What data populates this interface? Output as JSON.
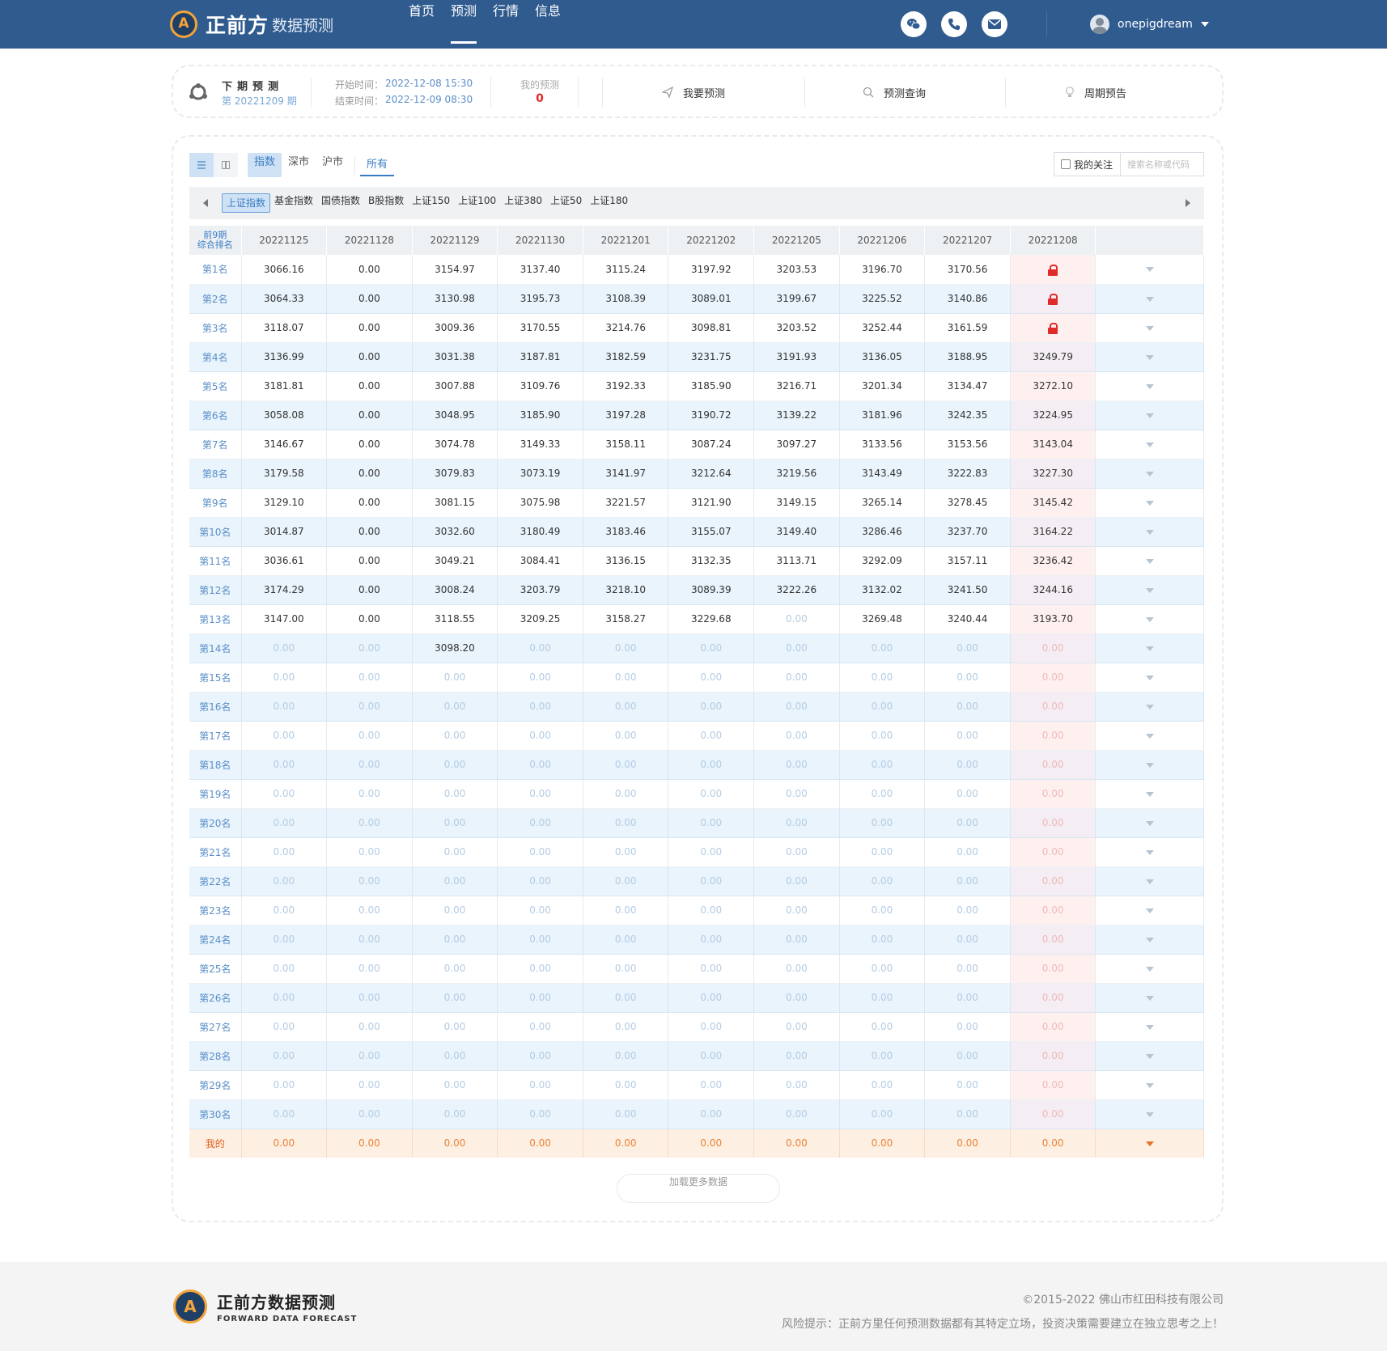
{
  "header": {
    "logo_main": "正前方",
    "logo_sub": "数据预测",
    "nav": [
      "首页",
      "预测",
      "行情",
      "信息"
    ],
    "active_nav": "预测",
    "username": "onepigdream"
  },
  "info": {
    "title": "下期预测",
    "period": "第 20221209 期",
    "start_label": "开始时间：",
    "start_time": "2022-12-08 15:30",
    "end_label": "结束时间：",
    "end_time": "2022-12-09 08:30",
    "my_prediction_label": "我的预测",
    "my_prediction_count": "0",
    "actions": [
      "我要预测",
      "预测查询",
      "周期预告"
    ]
  },
  "filters": {
    "categories": [
      "指数",
      "深市",
      "沪市"
    ],
    "active_category": "指数",
    "all_label": "所有",
    "follow_label": "我的关注",
    "search_placeholder": "搜索名称或代码"
  },
  "index_tabs": {
    "items": [
      "上证指数",
      "基金指数",
      "国债指数",
      "B股指数",
      "上证150",
      "上证100",
      "上证380",
      "上证50",
      "上证180"
    ],
    "active": "上证指数"
  },
  "table": {
    "rank_header_line1": "前9期",
    "rank_header_line2": "综合排名",
    "columns": [
      "20221125",
      "20221128",
      "20221129",
      "20221130",
      "20221201",
      "20221202",
      "20221205",
      "20221206",
      "20221207",
      "20221208"
    ],
    "rows": [
      {
        "rank": "第1名",
        "values": [
          "3066.16",
          "0.00",
          "3154.97",
          "3137.40",
          "3115.24",
          "3197.92",
          "3203.53",
          "3196.70",
          "3170.56",
          "lock"
        ]
      },
      {
        "rank": "第2名",
        "values": [
          "3064.33",
          "0.00",
          "3130.98",
          "3195.73",
          "3108.39",
          "3089.01",
          "3199.67",
          "3225.52",
          "3140.86",
          "lock"
        ]
      },
      {
        "rank": "第3名",
        "values": [
          "3118.07",
          "0.00",
          "3009.36",
          "3170.55",
          "3214.76",
          "3098.81",
          "3203.52",
          "3252.44",
          "3161.59",
          "lock"
        ]
      },
      {
        "rank": "第4名",
        "values": [
          "3136.99",
          "0.00",
          "3031.38",
          "3187.81",
          "3182.59",
          "3231.75",
          "3191.93",
          "3136.05",
          "3188.95",
          "3249.79"
        ]
      },
      {
        "rank": "第5名",
        "values": [
          "3181.81",
          "0.00",
          "3007.88",
          "3109.76",
          "3192.33",
          "3185.90",
          "3216.71",
          "3201.34",
          "3134.47",
          "3272.10"
        ]
      },
      {
        "rank": "第6名",
        "values": [
          "3058.08",
          "0.00",
          "3048.95",
          "3185.90",
          "3197.28",
          "3190.72",
          "3139.22",
          "3181.96",
          "3242.35",
          "3224.95"
        ]
      },
      {
        "rank": "第7名",
        "values": [
          "3146.67",
          "0.00",
          "3074.78",
          "3149.33",
          "3158.11",
          "3087.24",
          "3097.27",
          "3133.56",
          "3153.56",
          "3143.04"
        ]
      },
      {
        "rank": "第8名",
        "values": [
          "3179.58",
          "0.00",
          "3079.83",
          "3073.19",
          "3141.97",
          "3212.64",
          "3219.56",
          "3143.49",
          "3222.83",
          "3227.30"
        ]
      },
      {
        "rank": "第9名",
        "values": [
          "3129.10",
          "0.00",
          "3081.15",
          "3075.98",
          "3221.57",
          "3121.90",
          "3149.15",
          "3265.14",
          "3278.45",
          "3145.42"
        ]
      },
      {
        "rank": "第10名",
        "values": [
          "3014.87",
          "0.00",
          "3032.60",
          "3180.49",
          "3183.46",
          "3155.07",
          "3149.40",
          "3286.46",
          "3237.70",
          "3164.22"
        ]
      },
      {
        "rank": "第11名",
        "values": [
          "3036.61",
          "0.00",
          "3049.21",
          "3084.41",
          "3136.15",
          "3132.35",
          "3113.71",
          "3292.09",
          "3157.11",
          "3236.42"
        ]
      },
      {
        "rank": "第12名",
        "values": [
          "3174.29",
          "0.00",
          "3008.24",
          "3203.79",
          "3218.10",
          "3089.39",
          "3222.26",
          "3132.02",
          "3241.50",
          "3244.16"
        ]
      },
      {
        "rank": "第13名",
        "values": [
          "3147.00",
          "0.00",
          "3118.55",
          "3209.25",
          "3158.27",
          "3229.68",
          "0.00",
          "3269.48",
          "3240.44",
          "3193.70"
        ]
      },
      {
        "rank": "第14名",
        "values": [
          "0.00",
          "0.00",
          "3098.20",
          "0.00",
          "0.00",
          "0.00",
          "0.00",
          "0.00",
          "0.00",
          "0.00"
        ]
      },
      {
        "rank": "第15名",
        "values": [
          "0.00",
          "0.00",
          "0.00",
          "0.00",
          "0.00",
          "0.00",
          "0.00",
          "0.00",
          "0.00",
          "0.00"
        ]
      },
      {
        "rank": "第16名",
        "values": [
          "0.00",
          "0.00",
          "0.00",
          "0.00",
          "0.00",
          "0.00",
          "0.00",
          "0.00",
          "0.00",
          "0.00"
        ]
      },
      {
        "rank": "第17名",
        "values": [
          "0.00",
          "0.00",
          "0.00",
          "0.00",
          "0.00",
          "0.00",
          "0.00",
          "0.00",
          "0.00",
          "0.00"
        ]
      },
      {
        "rank": "第18名",
        "values": [
          "0.00",
          "0.00",
          "0.00",
          "0.00",
          "0.00",
          "0.00",
          "0.00",
          "0.00",
          "0.00",
          "0.00"
        ]
      },
      {
        "rank": "第19名",
        "values": [
          "0.00",
          "0.00",
          "0.00",
          "0.00",
          "0.00",
          "0.00",
          "0.00",
          "0.00",
          "0.00",
          "0.00"
        ]
      },
      {
        "rank": "第20名",
        "values": [
          "0.00",
          "0.00",
          "0.00",
          "0.00",
          "0.00",
          "0.00",
          "0.00",
          "0.00",
          "0.00",
          "0.00"
        ]
      },
      {
        "rank": "第21名",
        "values": [
          "0.00",
          "0.00",
          "0.00",
          "0.00",
          "0.00",
          "0.00",
          "0.00",
          "0.00",
          "0.00",
          "0.00"
        ]
      },
      {
        "rank": "第22名",
        "values": [
          "0.00",
          "0.00",
          "0.00",
          "0.00",
          "0.00",
          "0.00",
          "0.00",
          "0.00",
          "0.00",
          "0.00"
        ]
      },
      {
        "rank": "第23名",
        "values": [
          "0.00",
          "0.00",
          "0.00",
          "0.00",
          "0.00",
          "0.00",
          "0.00",
          "0.00",
          "0.00",
          "0.00"
        ]
      },
      {
        "rank": "第24名",
        "values": [
          "0.00",
          "0.00",
          "0.00",
          "0.00",
          "0.00",
          "0.00",
          "0.00",
          "0.00",
          "0.00",
          "0.00"
        ]
      },
      {
        "rank": "第25名",
        "values": [
          "0.00",
          "0.00",
          "0.00",
          "0.00",
          "0.00",
          "0.00",
          "0.00",
          "0.00",
          "0.00",
          "0.00"
        ]
      },
      {
        "rank": "第26名",
        "values": [
          "0.00",
          "0.00",
          "0.00",
          "0.00",
          "0.00",
          "0.00",
          "0.00",
          "0.00",
          "0.00",
          "0.00"
        ]
      },
      {
        "rank": "第27名",
        "values": [
          "0.00",
          "0.00",
          "0.00",
          "0.00",
          "0.00",
          "0.00",
          "0.00",
          "0.00",
          "0.00",
          "0.00"
        ]
      },
      {
        "rank": "第28名",
        "values": [
          "0.00",
          "0.00",
          "0.00",
          "0.00",
          "0.00",
          "0.00",
          "0.00",
          "0.00",
          "0.00",
          "0.00"
        ]
      },
      {
        "rank": "第29名",
        "values": [
          "0.00",
          "0.00",
          "0.00",
          "0.00",
          "0.00",
          "0.00",
          "0.00",
          "0.00",
          "0.00",
          "0.00"
        ]
      },
      {
        "rank": "第30名",
        "values": [
          "0.00",
          "0.00",
          "0.00",
          "0.00",
          "0.00",
          "0.00",
          "0.00",
          "0.00",
          "0.00",
          "0.00"
        ]
      }
    ],
    "mine": {
      "rank": "我的",
      "values": [
        "0.00",
        "0.00",
        "0.00",
        "0.00",
        "0.00",
        "0.00",
        "0.00",
        "0.00",
        "0.00",
        "0.00"
      ]
    }
  },
  "load_more": "加载更多数据",
  "footer": {
    "logo_main": "正前方数据预测",
    "logo_sub": "FORWARD DATA FORECAST",
    "copyright": "©2015-2022 佛山市红田科技有限公司",
    "risk": "风险提示：正前方里任何预测数据都有其特定立场，投资决策需要建立在独立思考之上！"
  },
  "colors": {
    "header_bg": "#2f5b8f",
    "accent": "#3a7cc4",
    "lock_red": "#e02b2b",
    "mine_orange": "#e8833a"
  },
  "icons": [
    "wechat-icon",
    "phone-icon",
    "mail-icon",
    "send-icon",
    "search-icon",
    "bulb-icon",
    "lock-icon",
    "list-view-icon",
    "grid-view-icon"
  ]
}
